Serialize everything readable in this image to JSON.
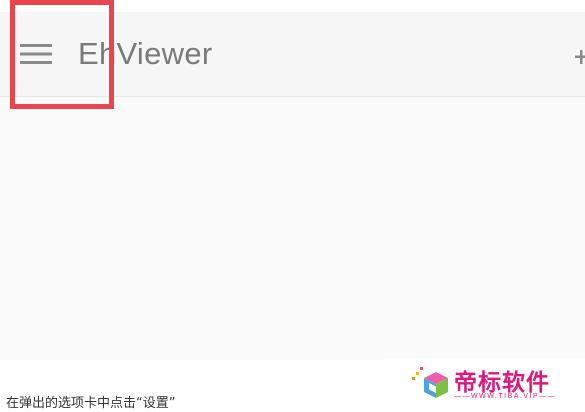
{
  "toolbar": {
    "title": "EhViewer",
    "menu_icon": "hamburger-menu-icon",
    "action_icon": "add-icon",
    "text_color": "#7a7a7a",
    "background": "#f6f6f6"
  },
  "annotation": {
    "highlight_color": "#e8454f",
    "highlight_target": "hamburger-menu-icon"
  },
  "caption": {
    "text": "在弹出的选项卡中点击“设置”"
  },
  "watermark": {
    "name": "帝标软件",
    "subtitle": "——WWW.TIBA.VIP——",
    "color": "#e0177a"
  }
}
